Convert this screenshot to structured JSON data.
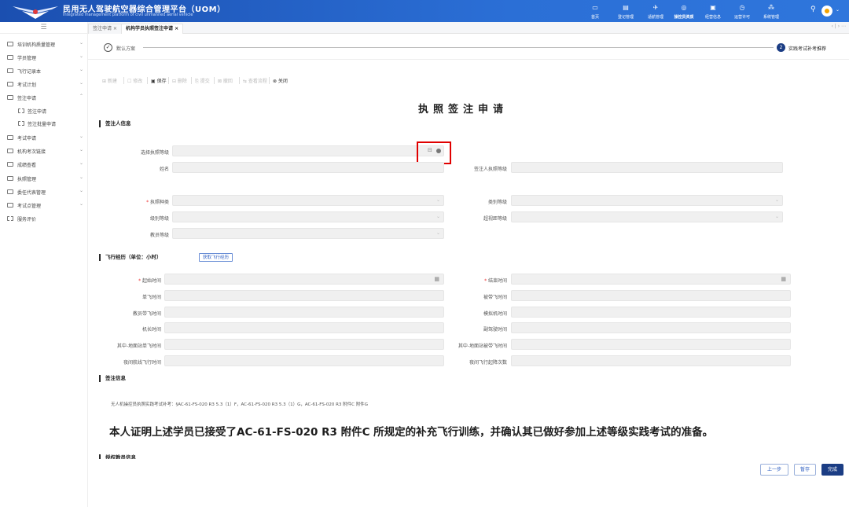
{
  "header": {
    "title": "民用无人驾驶航空器综合管理平台（UOM）",
    "subtitle": "Integrated management platform of civil unmanned aerial vehicle",
    "nav": [
      {
        "label": "首页",
        "icon": "monitor-icon"
      },
      {
        "label": "登记管理",
        "icon": "document-icon"
      },
      {
        "label": "适航管理",
        "icon": "plane-icon"
      },
      {
        "label": "操控员资质",
        "icon": "badge-icon",
        "active": true
      },
      {
        "label": "经营信息",
        "icon": "chart-icon"
      },
      {
        "label": "运营许可",
        "icon": "clock-icon"
      },
      {
        "label": "系统管理",
        "icon": "org-icon"
      }
    ]
  },
  "menu_toggle": "☰",
  "sidebar": {
    "items": [
      {
        "label": "培训机构质量管理",
        "caret": "⌄"
      },
      {
        "label": "学员管理",
        "caret": "⌄"
      },
      {
        "label": "飞行记录本",
        "caret": "⌄"
      },
      {
        "label": "考试计划",
        "caret": "⌄"
      },
      {
        "label": "签注申请",
        "caret": "⌃"
      },
      {
        "label": "签注申请",
        "sub": true
      },
      {
        "label": "签注批量申请",
        "sub": true
      },
      {
        "label": "考试申请",
        "caret": "⌄"
      },
      {
        "label": "机构考次链接",
        "caret": "⌄"
      },
      {
        "label": "成绩查看",
        "caret": "⌄"
      },
      {
        "label": "执照管理",
        "caret": "⌄"
      },
      {
        "label": "委任代表管理",
        "caret": "⌄"
      },
      {
        "label": "考试点管理",
        "caret": "⌄"
      },
      {
        "label": "服务评价",
        "sub": true,
        "top": true
      }
    ]
  },
  "tabs": [
    {
      "label": "签注申请 ×"
    },
    {
      "label": "机构学员执照签注申请 ×",
      "active": true
    }
  ],
  "tab_nav": "‹ | › ⋯",
  "steps": {
    "step1": {
      "icon": "✓",
      "label": "默认方案"
    },
    "step2": {
      "number": "2",
      "label": "实践考试补考推荐"
    }
  },
  "toolbar": [
    {
      "label": "⊞ 新建",
      "enabled": false
    },
    {
      "label": "☐ 修改",
      "enabled": false
    },
    {
      "label": "▣ 保存",
      "enabled": true
    },
    {
      "label": "⊟ 删除",
      "enabled": false
    },
    {
      "label": "⎘ 提交",
      "enabled": false
    },
    {
      "label": "⊠ 撤回",
      "enabled": false
    },
    {
      "label": "⇆ 查看流程",
      "enabled": false
    },
    {
      "label": "⊗ 关闭",
      "enabled": true
    }
  ],
  "form": {
    "title": "执照签注申请",
    "section_applicant": "签注人信息",
    "field_license_level": "选择执照等级",
    "field_name": "姓名",
    "field_signer_level": "签注人执照等级",
    "field_license_type": "执照种类",
    "field_category_level": "类别等级",
    "field_class_level": "级别等级",
    "field_bvlos_level": "超视距等级",
    "field_instructor_level": "教员等级",
    "section_flight": "飞行经历（单位：小时）",
    "fetch_button": "获取飞行经历",
    "flight_fields": [
      [
        "起始时间",
        "结束时间"
      ],
      [
        "单飞时间",
        "被带飞时间"
      ],
      [
        "教员带飞时间",
        "模拟机时间"
      ],
      [
        "机长时间",
        "副驾驶时间"
      ],
      [
        "其中-地面站单飞时间",
        "其中-地面站被带飞时间"
      ],
      [
        "夜间航线飞行时间",
        "夜间飞行起降次数"
      ]
    ],
    "section_sign": "签注信息",
    "sign_note": "无人机操控员执照实践考试补考：§AC-61-FS-020 R3 5.3（1）F，AC-61-FS-020 R3 5.3（1）G，AC-61-FS-020 R3 附件C 附件G",
    "statement": "本人证明上述学员已接受了AC-61-FS-020 R3 附件C 所规定的补充飞行训练，并确认其已做好参加上述等级实践考试的准备。",
    "section_instructor": "授权教员信息"
  },
  "buttons": {
    "prev": "上一步",
    "save": "暂存",
    "finish": "完成"
  },
  "colors": {
    "header": "#2b6fd6",
    "primary": "#1b3d84",
    "highlight": "#e00000"
  }
}
